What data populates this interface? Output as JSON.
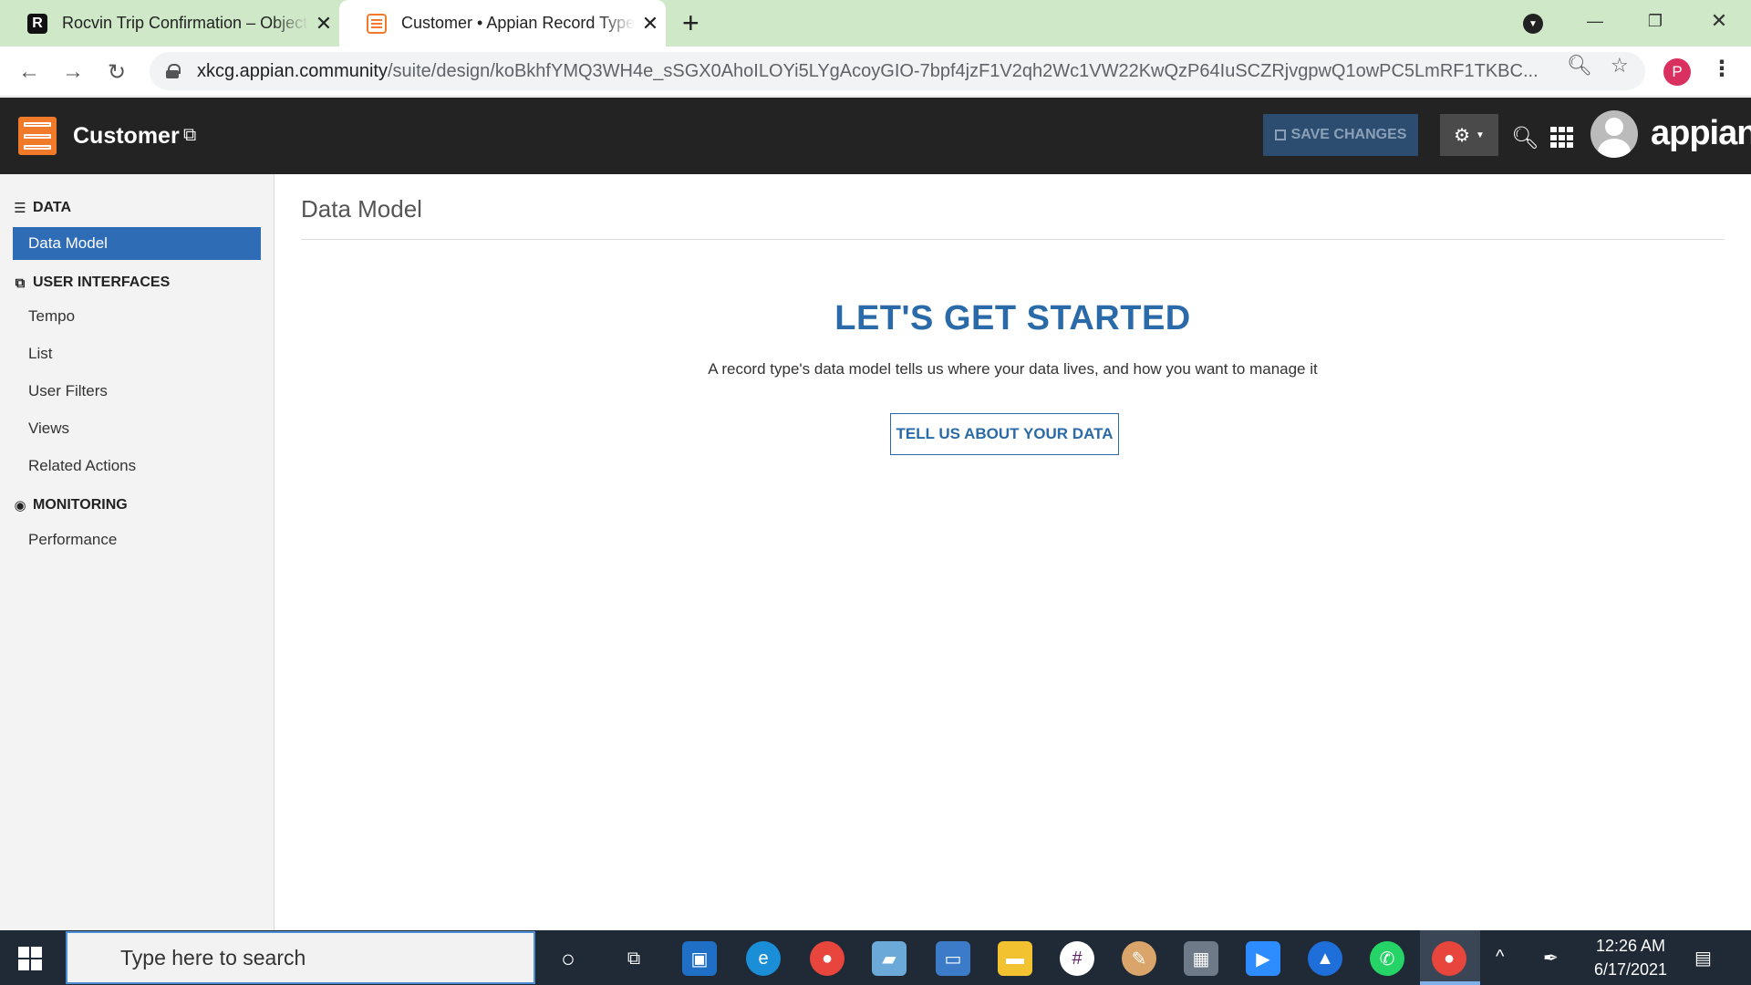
{
  "browser": {
    "tabs": [
      {
        "title": "Rocvin Trip Confirmation – Object",
        "favicon": "R"
      },
      {
        "title": "Customer • Appian Record Type"
      }
    ],
    "url_host": "xkcg.appian.community",
    "url_path": "/suite/design/koBkhfYMQ3WH4e_sSGX0AhoILOYi5LYgAcoyGIO-7bpf4jzF1V2qh2Wc1VW22KwQzP64IuSCZRjvgpwQ1owPC5LmRF1TKBC...",
    "profile_initial": "P"
  },
  "header": {
    "title": "Customer",
    "save_label": "SAVE CHANGES",
    "brand": "appian"
  },
  "sidebar": {
    "sections": [
      {
        "label": "DATA",
        "icon": "database-icon",
        "items": [
          {
            "label": "Data Model",
            "active": true
          }
        ]
      },
      {
        "label": "USER INTERFACES",
        "icon": "copy-icon",
        "items": [
          {
            "label": "Tempo"
          },
          {
            "label": "List"
          },
          {
            "label": "User Filters"
          },
          {
            "label": "Views"
          },
          {
            "label": "Related Actions"
          }
        ]
      },
      {
        "label": "MONITORING",
        "icon": "gauge-icon",
        "items": [
          {
            "label": "Performance"
          }
        ]
      }
    ]
  },
  "main": {
    "page_title": "Data Model",
    "hero_title": "LET'S GET STARTED",
    "hero_subtitle": "A record type's data model tells us where your data lives, and how you want to manage it",
    "cta_label": "TELL US ABOUT YOUR DATA"
  },
  "taskbar": {
    "search_placeholder": "Type here to search",
    "time": "12:26 AM",
    "date": "6/17/2021"
  },
  "colors": {
    "accent": "#2e6db5",
    "brand_orange": "#f07a2a",
    "header_bg": "#232323"
  }
}
